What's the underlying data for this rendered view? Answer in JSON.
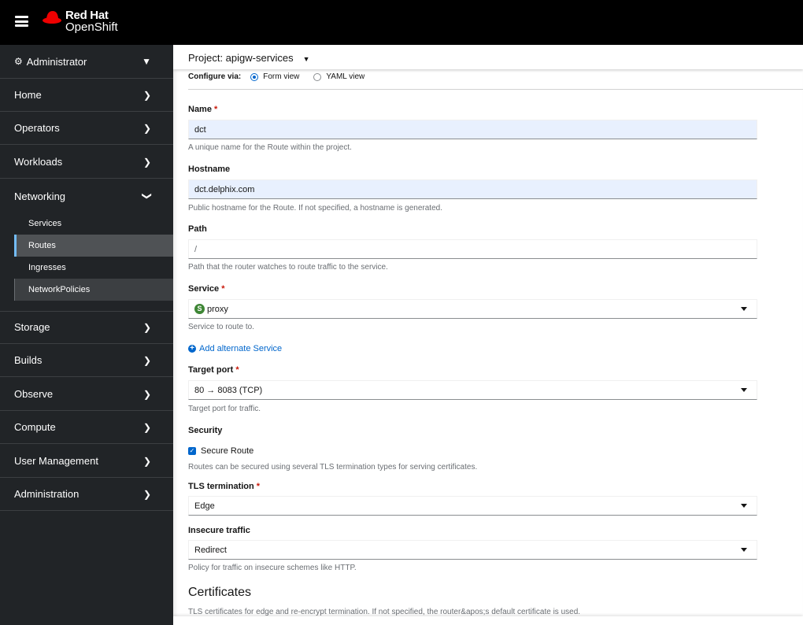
{
  "header": {
    "brand_line1": "Red Hat",
    "brand_line2": "OpenShift"
  },
  "sidebar": {
    "perspective": "Administrator",
    "items": [
      {
        "label": "Home"
      },
      {
        "label": "Operators"
      },
      {
        "label": "Workloads"
      },
      {
        "label": "Networking"
      },
      {
        "label": "Storage"
      },
      {
        "label": "Builds"
      },
      {
        "label": "Observe"
      },
      {
        "label": "Compute"
      },
      {
        "label": "User Management"
      },
      {
        "label": "Administration"
      }
    ],
    "networking_sub": [
      {
        "label": "Services"
      },
      {
        "label": "Routes"
      },
      {
        "label": "Ingresses"
      },
      {
        "label": "NetworkPolicies"
      }
    ]
  },
  "project": {
    "label": "Project: apigw-services"
  },
  "configure": {
    "label": "Configure via:",
    "form": "Form view",
    "yaml": "YAML view"
  },
  "form": {
    "name": {
      "label": "Name",
      "value": "dct",
      "help": "A unique name for the Route within the project."
    },
    "hostname": {
      "label": "Hostname",
      "value": "dct.delphix.com",
      "help": "Public hostname for the Route. If not specified, a hostname is generated."
    },
    "path": {
      "label": "Path",
      "value": "/",
      "help": "Path that the router watches to route traffic to the service."
    },
    "service": {
      "label": "Service",
      "badge": "S",
      "value": "proxy",
      "help": "Service to route to."
    },
    "add_service": "Add alternate Service",
    "target_port": {
      "label": "Target port",
      "value": "80 → 8083 (TCP)",
      "help": "Target port for traffic."
    },
    "security": {
      "label": "Security",
      "checkbox": "Secure Route",
      "help": "Routes can be secured using several TLS termination types for serving certificates."
    },
    "tls": {
      "label": "TLS termination",
      "value": "Edge"
    },
    "insecure": {
      "label": "Insecure traffic",
      "value": "Redirect",
      "help": "Policy for traffic on insecure schemes like HTTP."
    },
    "certificates": {
      "title": "Certificates",
      "help": "TLS certificates for edge and re-encrypt termination. If not specified, the router&apos;s default certificate is used."
    }
  },
  "required_mark": "*",
  "colors": {
    "accent": "#0066cc",
    "sidebar": "#212427",
    "service_badge": "#3e8635",
    "required": "#c9190b"
  }
}
